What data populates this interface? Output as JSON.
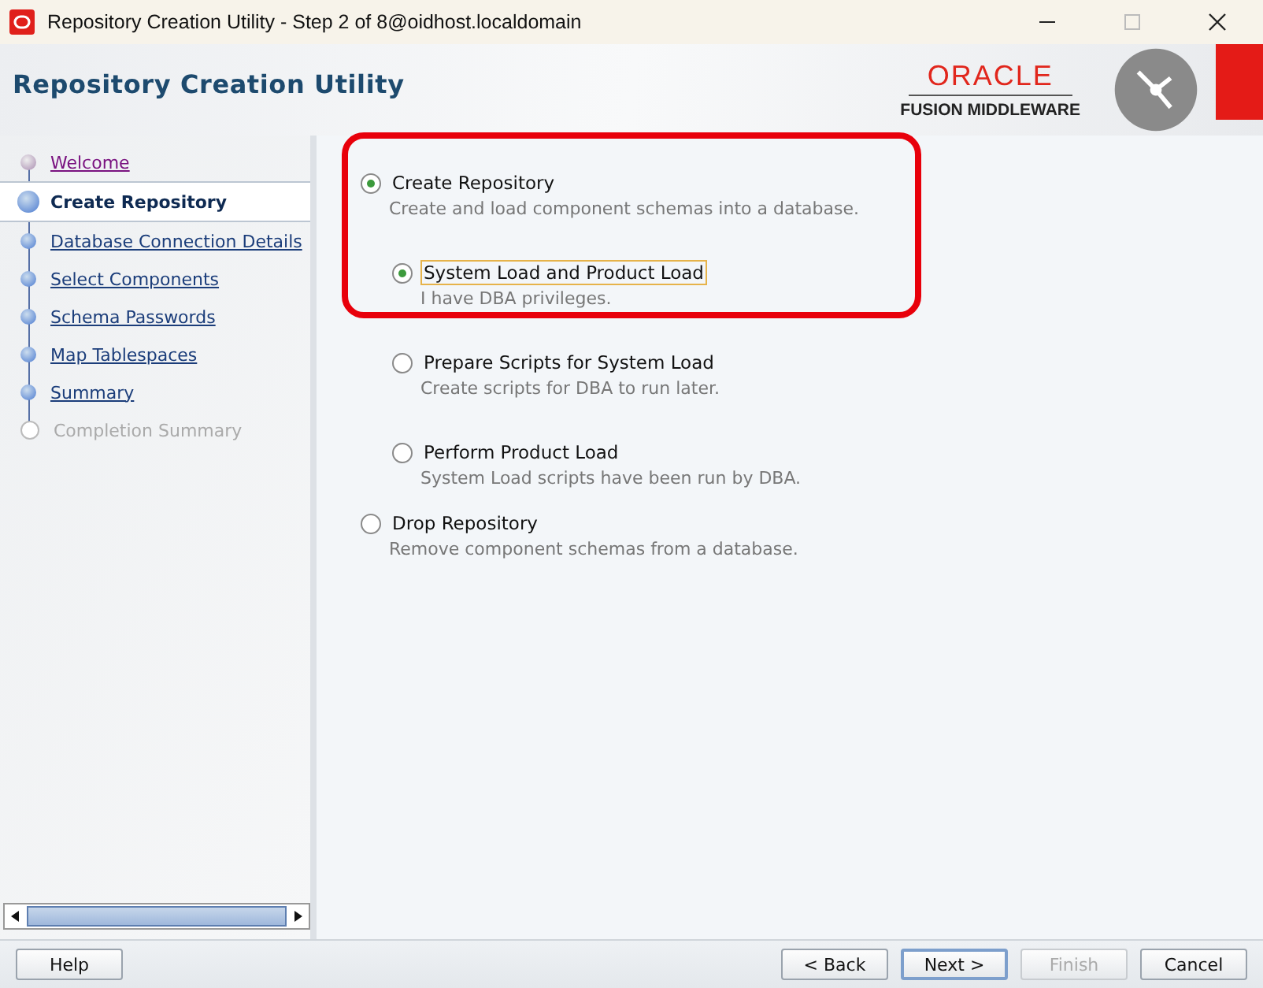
{
  "window": {
    "title": "Repository Creation Utility - Step 2 of 8@oidhost.localdomain"
  },
  "header": {
    "title": "Repository Creation Utility",
    "brand": "ORACLE",
    "subbrand": "FUSION MIDDLEWARE"
  },
  "steps": [
    {
      "label": "Welcome",
      "selected": false,
      "visited": true,
      "disabled": false
    },
    {
      "label": "Create Repository",
      "selected": true,
      "visited": false,
      "disabled": false
    },
    {
      "label": "Database Connection Details",
      "selected": false,
      "visited": false,
      "disabled": false
    },
    {
      "label": "Select Components",
      "selected": false,
      "visited": false,
      "disabled": false
    },
    {
      "label": "Schema Passwords",
      "selected": false,
      "visited": false,
      "disabled": false
    },
    {
      "label": "Map Tablespaces",
      "selected": false,
      "visited": false,
      "disabled": false
    },
    {
      "label": "Summary",
      "selected": false,
      "visited": false,
      "disabled": false
    },
    {
      "label": "Completion Summary",
      "selected": false,
      "visited": false,
      "disabled": true
    }
  ],
  "annotation": {
    "kind": "highlight-box"
  },
  "options": [
    {
      "label": "Create Repository",
      "description": "Create and load component schemas into a database.",
      "selected": true,
      "children": [
        {
          "label": "System Load and Product Load",
          "description": "I have DBA privileges.",
          "selected": true,
          "focused": true
        },
        {
          "label": "Prepare Scripts for System Load",
          "description": "Create scripts for DBA to run later.",
          "selected": false,
          "focused": false
        },
        {
          "label": "Perform Product Load",
          "description": "System Load scripts have been run by DBA.",
          "selected": false,
          "focused": false
        }
      ]
    },
    {
      "label": "Drop Repository",
      "description": "Remove component schemas from a database.",
      "selected": false
    }
  ],
  "buttons": [
    {
      "label": "Help",
      "kind": "left",
      "disabled": false,
      "default": false
    },
    {
      "label": "< Back",
      "kind": "right",
      "disabled": false,
      "default": false
    },
    {
      "label": "Next >",
      "kind": "right",
      "disabled": false,
      "default": true
    },
    {
      "label": "Finish",
      "kind": "right",
      "disabled": true,
      "default": false
    },
    {
      "label": "Cancel",
      "kind": "right",
      "disabled": false,
      "default": false
    }
  ]
}
